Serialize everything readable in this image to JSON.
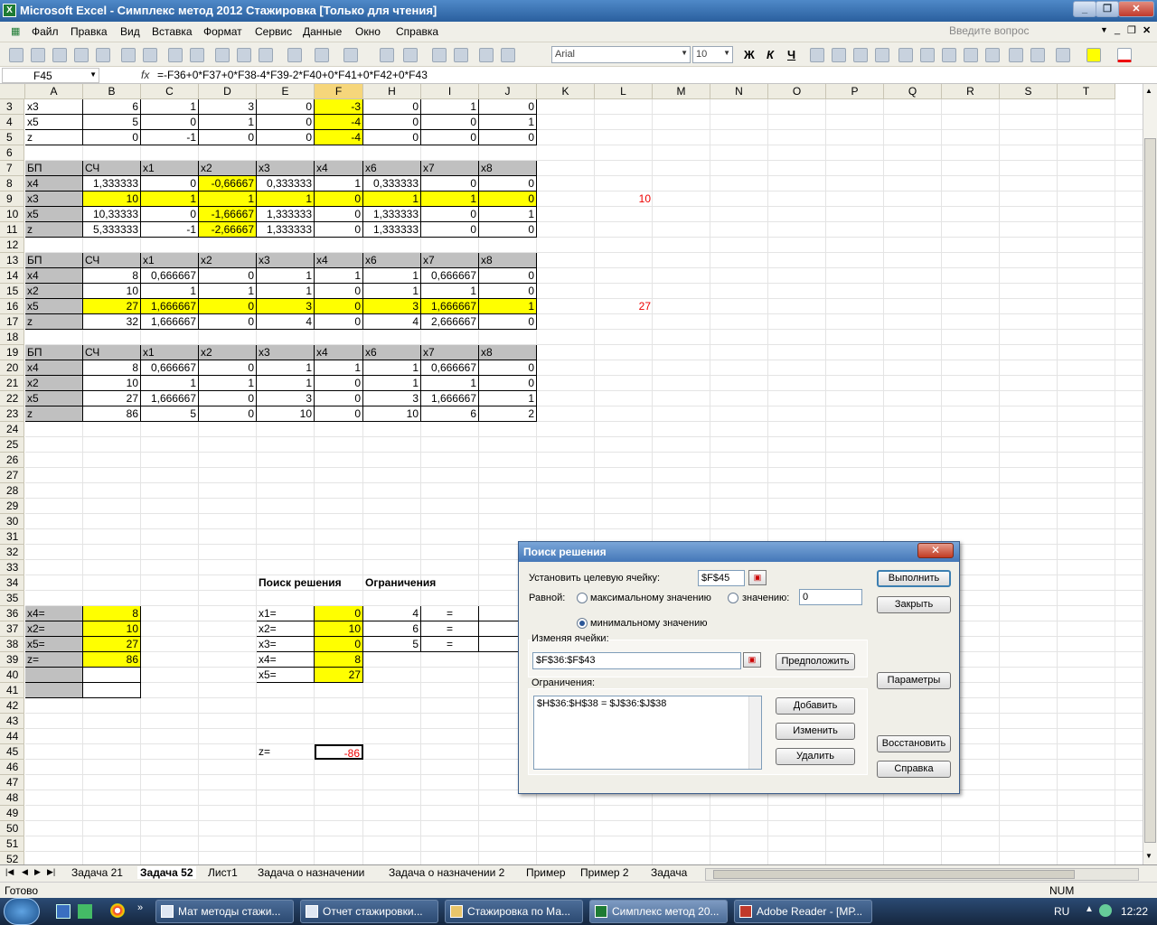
{
  "app": {
    "title": "Microsoft Excel - Симплекс метод 2012 Стажировка  [Только для чтения]"
  },
  "menu": [
    "Файл",
    "Правка",
    "Вид",
    "Вставка",
    "Формат",
    "Сервис",
    "Данные",
    "Окно",
    "Справка"
  ],
  "ask_placeholder": "Введите вопрос",
  "toolbar": {
    "font": "Arial",
    "size": "10",
    "bold": "Ж",
    "italic": "К",
    "underline": "Ч"
  },
  "formula_bar": {
    "name_box": "F45",
    "fx": "fx",
    "formula": "=-F36+0*F37+0*F38-4*F39-2*F40+0*F41+0*F42+0*F43"
  },
  "columns": [
    "A",
    "B",
    "C",
    "D",
    "E",
    "F",
    "H",
    "I",
    "J",
    "K",
    "L",
    "M",
    "N",
    "O",
    "P",
    "Q",
    "R",
    "S",
    "T"
  ],
  "rows": [
    "3",
    "4",
    "5",
    "6",
    "7",
    "8",
    "9",
    "10",
    "11",
    "12",
    "13",
    "14",
    "15",
    "16",
    "17",
    "18",
    "19",
    "20",
    "21",
    "22",
    "23",
    "24",
    "25",
    "26",
    "27",
    "28",
    "29",
    "30",
    "31",
    "32",
    "33",
    "34",
    "35",
    "36",
    "37",
    "38",
    "39",
    "40",
    "41",
    "42",
    "43",
    "44",
    "45",
    "46",
    "47",
    "48",
    "49",
    "50",
    "51",
    "52"
  ],
  "cells": {
    "A3": "x3",
    "B3": "6",
    "C3": "1",
    "D3": "3",
    "E3": "0",
    "F3": "-3",
    "H3": "0",
    "I3": "1",
    "J3": "0",
    "A4": "x5",
    "B4": "5",
    "C4": "0",
    "D4": "1",
    "E4": "0",
    "F4": "-4",
    "H4": "0",
    "I4": "0",
    "J4": "1",
    "A5": "z",
    "B5": "0",
    "C5": "-1",
    "D5": "0",
    "E5": "0",
    "F5": "-4",
    "H5": "0",
    "I5": "0",
    "J5": "0",
    "A7": "БП",
    "B7": "СЧ",
    "C7": "x1",
    "D7": "x2",
    "E7": "x3",
    "F7": "x4",
    "H7": "x6",
    "I7": "x7",
    "J7": "x8",
    "A8": "x4",
    "B8": "1,333333",
    "C8": "0",
    "D8": "-0,66667",
    "E8": "0,333333",
    "F8": "1",
    "H8": "0,333333",
    "I8": "0",
    "J8": "0",
    "A9": "x3",
    "B9": "10",
    "C9": "1",
    "D9": "1",
    "E9": "1",
    "F9": "0",
    "H9": "1",
    "I9": "1",
    "J9": "0",
    "L9": "10",
    "A10": "x5",
    "B10": "10,33333",
    "C10": "0",
    "D10": "-1,66667",
    "E10": "1,333333",
    "F10": "0",
    "H10": "1,333333",
    "I10": "0",
    "J10": "1",
    "A11": "z",
    "B11": "5,333333",
    "C11": "-1",
    "D11": "-2,66667",
    "E11": "1,333333",
    "F11": "0",
    "H11": "1,333333",
    "I11": "0",
    "J11": "0",
    "A13": "БП",
    "B13": "СЧ",
    "C13": "x1",
    "D13": "x2",
    "E13": "x3",
    "F13": "x4",
    "H13": "x6",
    "I13": "x7",
    "J13": "x8",
    "A14": "x4",
    "B14": "8",
    "C14": "0,666667",
    "D14": "0",
    "E14": "1",
    "F14": "1",
    "H14": "1",
    "I14": "0,666667",
    "J14": "0",
    "A15": "x2",
    "B15": "10",
    "C15": "1",
    "D15": "1",
    "E15": "1",
    "F15": "0",
    "H15": "1",
    "I15": "1",
    "J15": "0",
    "A16": "x5",
    "B16": "27",
    "C16": "1,666667",
    "D16": "0",
    "E16": "3",
    "F16": "0",
    "H16": "3",
    "I16": "1,666667",
    "J16": "1",
    "L16": "27",
    "A17": "z",
    "B17": "32",
    "C17": "1,666667",
    "D17": "0",
    "E17": "4",
    "F17": "0",
    "H17": "4",
    "I17": "2,666667",
    "J17": "0",
    "A19": "БП",
    "B19": "СЧ",
    "C19": "x1",
    "D19": "x2",
    "E19": "x3",
    "F19": "x4",
    "H19": "x6",
    "I19": "x7",
    "J19": "x8",
    "A20": "x4",
    "B20": "8",
    "C20": "0,666667",
    "D20": "0",
    "E20": "1",
    "F20": "1",
    "H20": "1",
    "I20": "0,666667",
    "J20": "0",
    "A21": "x2",
    "B21": "10",
    "C21": "1",
    "D21": "1",
    "E21": "1",
    "F21": "0",
    "H21": "1",
    "I21": "1",
    "J21": "0",
    "A22": "x5",
    "B22": "27",
    "C22": "1,666667",
    "D22": "0",
    "E22": "3",
    "F22": "0",
    "H22": "3",
    "I22": "1,666667",
    "J22": "1",
    "A23": "z",
    "B23": "86",
    "C23": "5",
    "D23": "0",
    "E23": "10",
    "F23": "0",
    "H23": "10",
    "I23": "6",
    "J23": "2",
    "E34": "Поиск решения",
    "H34": "Ограничения",
    "A36": "x4=",
    "B36": "8",
    "E36": "x1=",
    "F36": "0",
    "H36": "4",
    "I36": "=",
    "A37": "x2=",
    "B37": "10",
    "E37": "x2=",
    "F37": "10",
    "H37": "6",
    "I37": "=",
    "A38": "x5=",
    "B38": "27",
    "E38": "x3=",
    "F38": "0",
    "H38": "5",
    "I38": "=",
    "A39": "z=",
    "B39": "86",
    "E39": "x4=",
    "F39": "8",
    "E40": "x5=",
    "F40": "27",
    "E45": "z=",
    "F45": "-86"
  },
  "sheet_tabs": [
    "Задача 21",
    "Задача 52",
    "Лист1",
    "Задача о назначении",
    "Задача о назначении 2",
    "Пример",
    "Пример 2",
    "Задача"
  ],
  "active_tab": "Задача 52",
  "status": {
    "ready": "Готово",
    "num": "NUM"
  },
  "taskbar": {
    "items": [
      "Мат методы стажи...",
      "Отчет стажировки...",
      "Стажировка по Ма...",
      "Симплекс метод 20...",
      "Adobe Reader - [МР..."
    ],
    "lang": "RU",
    "time": "12:22"
  },
  "solver": {
    "title": "Поиск решения",
    "target_label": "Установить целевую ячейку:",
    "target_value": "$F$45",
    "equal_label": "Равной:",
    "max_label": "максимальному значению",
    "value_label": "значению:",
    "value_input": "0",
    "min_label": "минимальному значению",
    "changing_label": "Изменяя ячейки:",
    "changing_value": "$F$36:$F$43",
    "guess": "Предположить",
    "constraints_label": "Ограничения:",
    "constraint1": "$H$36:$H$38 = $J$36:$J$38",
    "add": "Добавить",
    "change": "Изменить",
    "delete": "Удалить",
    "run": "Выполнить",
    "close": "Закрыть",
    "options": "Параметры",
    "reset": "Восстановить",
    "help": "Справка"
  }
}
